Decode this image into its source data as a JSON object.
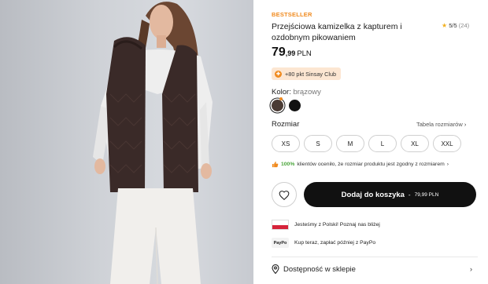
{
  "product": {
    "badge": "BESTSELLER",
    "title": "Przejściowa kamizelka z kapturem i ozdobnym pikowaniem",
    "rating": {
      "star": "★",
      "score": "5/5",
      "count": "(24)"
    },
    "price": {
      "integer": "79",
      "decimal": ",99",
      "currency": "PLN"
    },
    "club": "+80 pkt Sinsay Club",
    "color": {
      "label": "Kolor: ",
      "value": "brązowy",
      "swatches": [
        "#4a3b34",
        "#111111"
      ]
    },
    "size": {
      "label": "Rozmiar",
      "table_link": "Tabela rozmiarów",
      "options": [
        "XS",
        "S",
        "M",
        "L",
        "XL",
        "XXL"
      ]
    },
    "fit": {
      "pct": "100%",
      "text": "klientów oceniło, że rozmiar produktu jest zgodny z rozmiarem"
    },
    "cart": {
      "label": "Dodaj do koszyka",
      "sep": "-",
      "price": "79,99 PLN"
    },
    "info": {
      "made_in": "Jesteśmy z Polski! Poznaj nas bliżej",
      "paypo_logo": "PayPo",
      "paypo": "Kup teraz, zapłać później z PayPo"
    },
    "store": "Dostępność w sklepie"
  },
  "colors": {
    "accent": "#f08a1e",
    "button": "#111111",
    "fit_green": "#4aa53a"
  }
}
